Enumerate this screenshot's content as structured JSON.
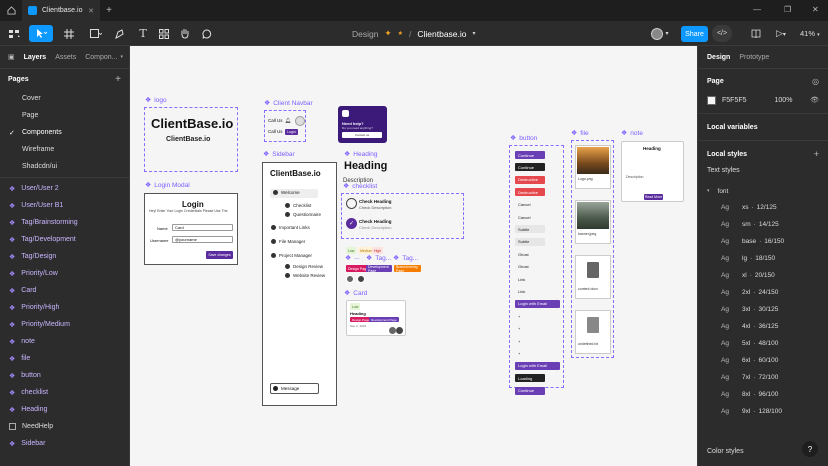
{
  "tabbar": {
    "active_tab": "Clientbase.io"
  },
  "toolbar": {
    "mode_label": "Design",
    "file_name": "Clientbase.io",
    "share_label": "Share",
    "zoom": "41%"
  },
  "left_panel": {
    "tabs": [
      "Layers",
      "Assets",
      "Compon..."
    ],
    "pages_title": "Pages",
    "pages": [
      "Cover",
      "Page",
      "Components",
      "Wireframe",
      "Shadcdn/ui"
    ],
    "current_page": "Components",
    "layers": [
      {
        "label": "User/User 2",
        "kind": "component"
      },
      {
        "label": "User/User B1",
        "kind": "component"
      },
      {
        "label": "Tag/Brainstorming",
        "kind": "component"
      },
      {
        "label": "Tag/Development",
        "kind": "component"
      },
      {
        "label": "Tag/Design",
        "kind": "component"
      },
      {
        "label": "Priority/Low",
        "kind": "component"
      },
      {
        "label": "Card",
        "kind": "component"
      },
      {
        "label": "Priority/High",
        "kind": "component"
      },
      {
        "label": "Priority/Medium",
        "kind": "component"
      },
      {
        "label": "note",
        "kind": "component"
      },
      {
        "label": "file",
        "kind": "component"
      },
      {
        "label": "button",
        "kind": "component"
      },
      {
        "label": "checklist",
        "kind": "component"
      },
      {
        "label": "Heading",
        "kind": "component"
      },
      {
        "label": "NeedHelp",
        "kind": "frame"
      },
      {
        "label": "Sidebar",
        "kind": "component"
      }
    ]
  },
  "canvas": {
    "labels": {
      "logo": "logo",
      "navbar": "Client Navbar",
      "sidebar": "Sidebar",
      "heading": "Heading",
      "checklist": "checklist",
      "button": "button",
      "file": "file",
      "note": "note",
      "login": "Login Modal",
      "card": "Card",
      "tag1": "Tag...",
      "tag2": "Tag..."
    },
    "logo": {
      "big": "ClientBase.io",
      "small": "ClientBase.io"
    },
    "navbar": {
      "call1": "Call Us",
      "call2": "Call Us",
      "login": "Login"
    },
    "needhelp": {
      "title": "Need help?",
      "sub": "Do you need anything?",
      "btn": "Contact us"
    },
    "login_modal": {
      "title": "Login",
      "subtitle": "Hey! Enter Your Login Credentials Please Use The",
      "name_label": "Name",
      "name_value": "Card",
      "username_label": "Username",
      "username_value": "@yourname",
      "submit": "Save changes"
    },
    "sidebar": {
      "brand": "ClientBase.io",
      "items": [
        "Welcome",
        "Checklist",
        "Questionnaire",
        "Important Links",
        "File Manager",
        "Project Manager",
        "Design Review",
        "Website Review"
      ],
      "message": "Message"
    },
    "heading": {
      "big": "Heading",
      "desc": "Description"
    },
    "checklist": {
      "item1_title": "Check Heading",
      "item1_desc": "Check Description",
      "item2_title": "Check Heading",
      "item2_desc": "Check Description"
    },
    "tags": [
      "Design Page",
      "Development Page",
      "Brainstorming Page"
    ],
    "priorities": [
      "Low",
      "Medium",
      "High"
    ],
    "card": {
      "tag": "Low",
      "title": "Heading",
      "date": "Sep 2, 2024",
      "pill1": "Design Page",
      "pill2": "Development Page"
    },
    "buttons": [
      {
        "label": "Continue",
        "style": "primary"
      },
      {
        "label": "Continue",
        "style": "dark"
      },
      {
        "label": "Destructive",
        "style": "destructive"
      },
      {
        "label": "Destructive",
        "style": "destructive"
      },
      {
        "label": "Cancel",
        "style": "outline"
      },
      {
        "label": "Cancel",
        "style": "outline"
      },
      {
        "label": "Subtle",
        "style": "subtle"
      },
      {
        "label": "Subtle",
        "style": "subtle"
      },
      {
        "label": "Ghost",
        "style": "ghost"
      },
      {
        "label": "Ghost",
        "style": "ghost"
      },
      {
        "label": "Link",
        "style": "ghost"
      },
      {
        "label": "Link",
        "style": "ghost"
      },
      {
        "label": "Login with Email",
        "style": "primary"
      },
      {
        "label": "+",
        "style": "ghost"
      },
      {
        "label": "+",
        "style": "ghost"
      },
      {
        "label": "+",
        "style": "ghost"
      },
      {
        "label": "+",
        "style": "ghost"
      },
      {
        "label": "Login with Email",
        "style": "primary"
      },
      {
        "label": "Loading",
        "style": "dark"
      },
      {
        "label": "Continue",
        "style": "primary"
      }
    ],
    "files": [
      "Logo.png",
      "banner.jpeg",
      "content.docx",
      "undefined.txt"
    ],
    "note": {
      "title": "Heading",
      "desc": "Description",
      "btn": "Read More"
    }
  },
  "right_panel": {
    "tabs": [
      "Design",
      "Prototype"
    ],
    "page_title": "Page",
    "bg_hex": "F5F5F5",
    "bg_opacity": "100%",
    "local_variables": "Local variables",
    "local_styles": "Local styles",
    "text_styles": "Text styles",
    "font_group": "font",
    "styles": [
      {
        "name": "xs",
        "spec": "12/125"
      },
      {
        "name": "sm",
        "spec": "14/125"
      },
      {
        "name": "base",
        "spec": "16/150"
      },
      {
        "name": "lg",
        "spec": "18/150"
      },
      {
        "name": "xl",
        "spec": "20/150"
      },
      {
        "name": "2xl",
        "spec": "24/150"
      },
      {
        "name": "3xl",
        "spec": "30/125"
      },
      {
        "name": "4xl",
        "spec": "36/125"
      },
      {
        "name": "5xl",
        "spec": "48/100"
      },
      {
        "name": "6xl",
        "spec": "60/100"
      },
      {
        "name": "7xl",
        "spec": "72/100"
      },
      {
        "name": "8xl",
        "spec": "96/100"
      },
      {
        "name": "9xl",
        "spec": "128/100"
      }
    ],
    "color_styles": "Color styles"
  },
  "colors": {
    "accent": "#0d99ff",
    "purple": "#7c5cff",
    "brand": "#5b2c9e",
    "destructive": "#e5484d"
  }
}
